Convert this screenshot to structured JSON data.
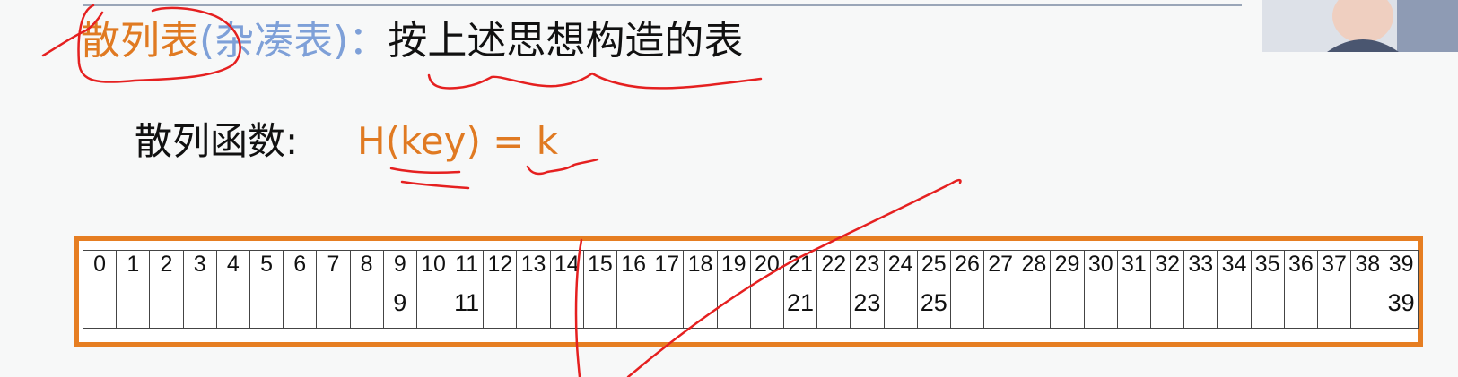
{
  "title": {
    "term": "散列表",
    "alias": "(杂凑表)：",
    "description": "按上述思想构造的表"
  },
  "hash_function": {
    "label": "散列函数:",
    "formula": "H(key) = k"
  },
  "hash_table": {
    "indices": [
      "0",
      "1",
      "2",
      "3",
      "4",
      "5",
      "6",
      "7",
      "8",
      "9",
      "10",
      "11",
      "12",
      "13",
      "14",
      "15",
      "16",
      "17",
      "18",
      "19",
      "20",
      "21",
      "22",
      "23",
      "24",
      "25",
      "26",
      "27",
      "28",
      "29",
      "30",
      "31",
      "32",
      "33",
      "34",
      "35",
      "36",
      "37",
      "38",
      "39"
    ],
    "values": [
      "",
      "",
      "",
      "",
      "",
      "",
      "",
      "",
      "",
      "9",
      "",
      "11",
      "",
      "",
      "",
      "",
      "",
      "",
      "",
      "",
      "",
      "21",
      "",
      "23",
      "",
      "25",
      "",
      "",
      "",
      "",
      "",
      "",
      "",
      "",
      "",
      "",
      "",
      "",
      "",
      "39"
    ]
  },
  "colors": {
    "accent_orange": "#e07a22",
    "alias_blue": "#7ea0d8",
    "annotation_red": "#e52020"
  }
}
